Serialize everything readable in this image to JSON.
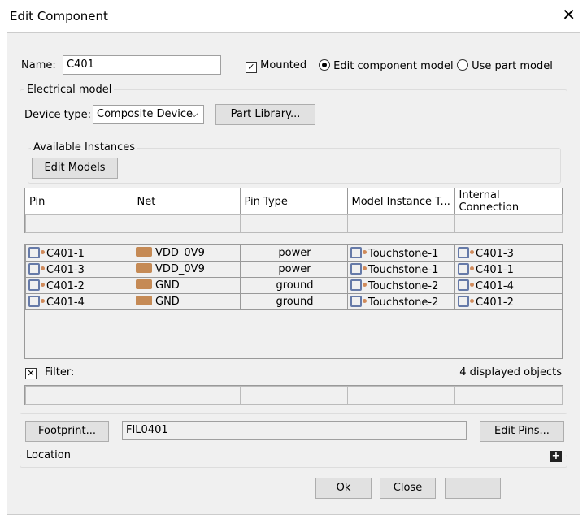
{
  "window": {
    "title": "Edit Component"
  },
  "name_label": "Name:",
  "name_value": "C401",
  "mounted_label": "Mounted",
  "edit_model_label": "Edit component model",
  "use_part_label": "Use part model",
  "electrical": {
    "title": "Electrical model",
    "device_type_label": "Device type:",
    "device_type_value": "Composite Device",
    "part_library": "Part Library..."
  },
  "instances": {
    "title": "Available Instances",
    "edit_models": "Edit Models"
  },
  "columns": [
    "Pin",
    "Net",
    "Pin Type",
    "Model Instance T...",
    "Internal Connection"
  ],
  "rows": [
    {
      "pin": "C401-1",
      "net": "VDD_0V9",
      "type": "power",
      "model": "Touchstone-1",
      "conn": "C401-3"
    },
    {
      "pin": "C401-3",
      "net": "VDD_0V9",
      "type": "power",
      "model": "Touchstone-1",
      "conn": "C401-1"
    },
    {
      "pin": "C401-2",
      "net": "GND",
      "type": "ground",
      "model": "Touchstone-2",
      "conn": "C401-4"
    },
    {
      "pin": "C401-4",
      "net": "GND",
      "type": "ground",
      "model": "Touchstone-2",
      "conn": "C401-2"
    }
  ],
  "filter_label": "Filter:",
  "displayed": "4 displayed objects",
  "footprint_btn": "Footprint...",
  "footprint_value": "FIL0401",
  "edit_pins": "Edit Pins...",
  "location_label": "Location",
  "ok": "Ok",
  "close": "Close"
}
